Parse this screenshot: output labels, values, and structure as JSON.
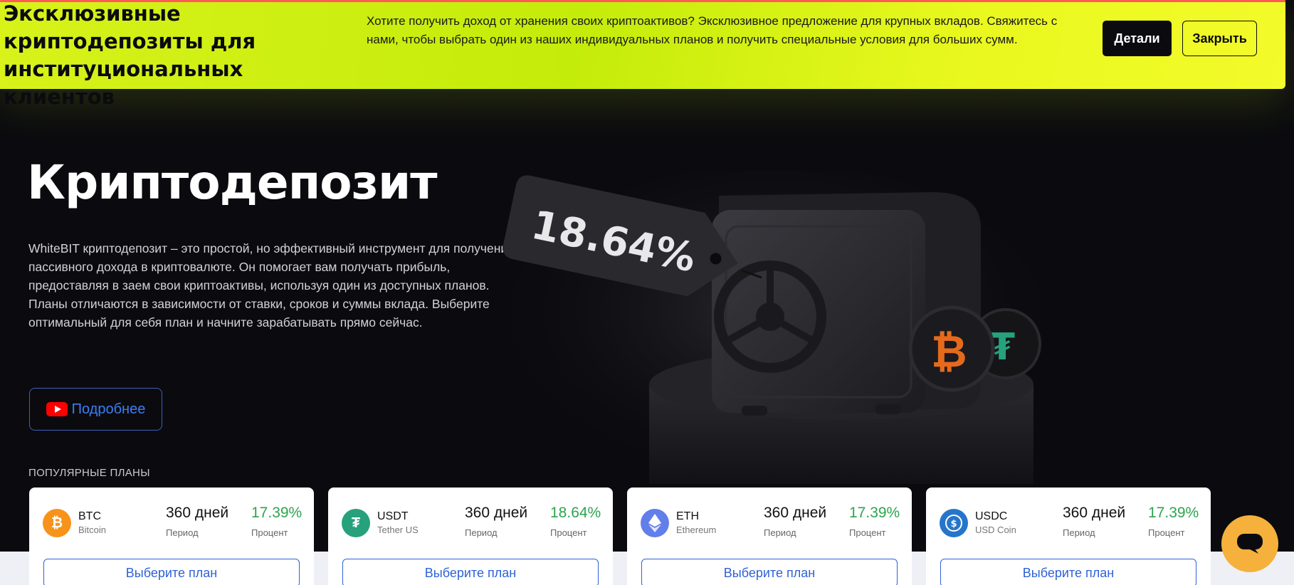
{
  "banner": {
    "title": "Эксклюзивные криптодепозиты для институциональных клиентов",
    "text": "Хотите получить доход от хранения своих криптоактивов? Эксклюзивное предложение для крупных вкладов. Свяжитесь с нами, чтобы выбрать один из наших индивидуальных планов и получить специальные условия для больших сумм.",
    "details_label": "Детали",
    "close_label": "Закрыть"
  },
  "hero": {
    "title": "Криптодепозит",
    "description": "WhiteBIT криптодепозит – это простой, но эффективный инструмент для получения пассивного дохода в криптовалюте. Он помогает вам получать прибыль, предоставляя в заем свои криптоактивы, используя один из доступных планов. Планы отличаются в зависимости от ставки, сроков и суммы вклада. Выберите оптимальный для себя план и начните зарабатывать прямо сейчас.",
    "more_label": "Подробнее",
    "illustration_tag": "18.64%"
  },
  "plans": {
    "heading": "ПОПУЛЯРНЫЕ ПЛАНЫ",
    "items": [
      {
        "code": "BTC",
        "name": "Bitcoin",
        "period": "360 дней",
        "period_label": "Период",
        "percent": "17.39%",
        "percent_label": "Процент",
        "button": "Выберите план",
        "icon": "bitcoin-icon",
        "color": "#f7931a"
      },
      {
        "code": "USDT",
        "name": "Tether US",
        "period": "360 дней",
        "period_label": "Период",
        "percent": "18.64%",
        "percent_label": "Процент",
        "button": "Выберите план",
        "icon": "tether-icon",
        "color": "#26a17b"
      },
      {
        "code": "ETH",
        "name": "Ethereum",
        "period": "360 дней",
        "period_label": "Период",
        "percent": "17.39%",
        "percent_label": "Процент",
        "button": "Выберите план",
        "icon": "ethereum-icon",
        "color": "#627eea"
      },
      {
        "code": "USDC",
        "name": "USD Coin",
        "period": "360 дней",
        "period_label": "Период",
        "percent": "17.39%",
        "percent_label": "Процент",
        "button": "Выберите план",
        "icon": "usdc-icon",
        "color": "#2775ca"
      }
    ]
  },
  "colors": {
    "banner": "#d8f21a",
    "accent_blue": "#2f62d6",
    "percent_green": "#2da44e",
    "chat": "#f5b13b"
  }
}
